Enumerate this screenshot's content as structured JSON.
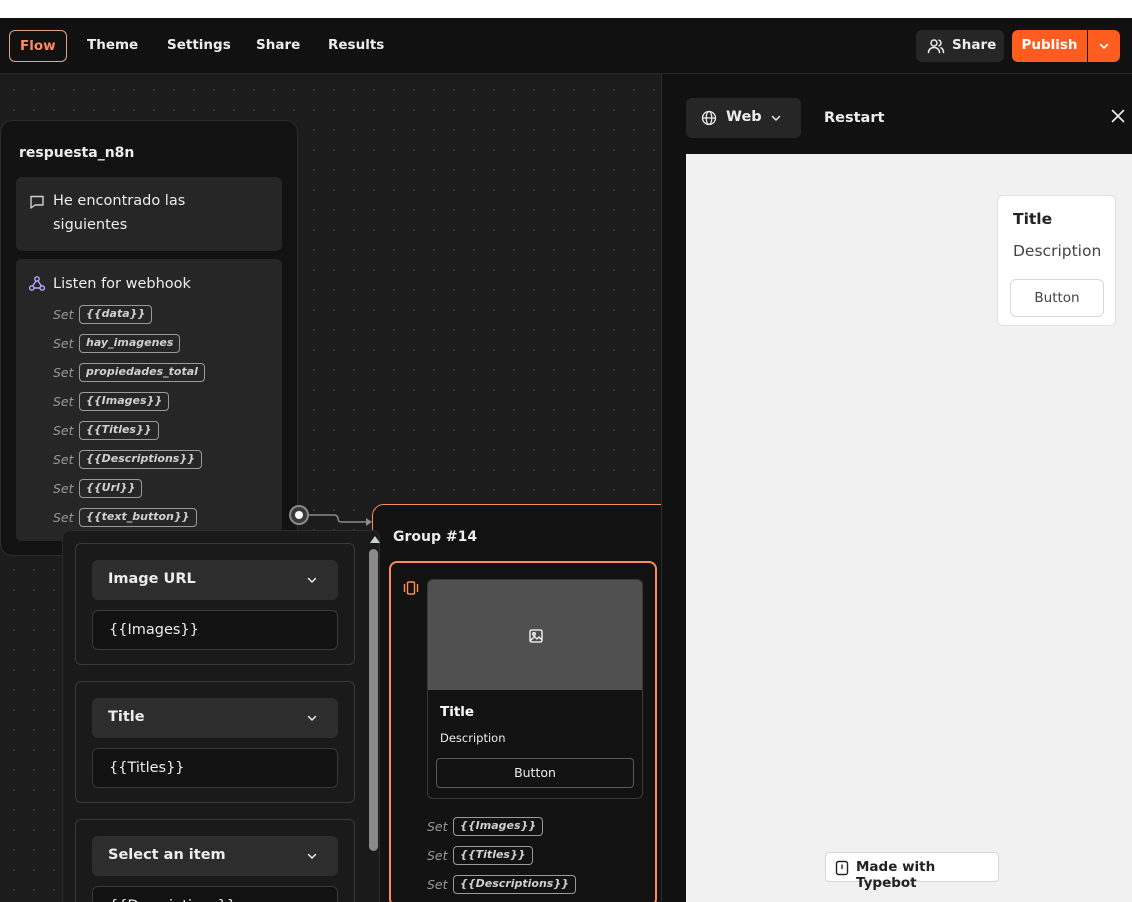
{
  "topbar": {
    "tabs": [
      {
        "label": "Flow",
        "active": true
      },
      {
        "label": "Theme",
        "active": false
      },
      {
        "label": "Settings",
        "active": false
      },
      {
        "label": "Share",
        "active": false
      },
      {
        "label": "Results",
        "active": false
      }
    ],
    "share_label": "Share",
    "publish_label": "Publish",
    "accent_color": "#ff5c1f"
  },
  "canvas": {
    "group1": {
      "title": "respuesta_n8n",
      "text_block": {
        "icon": "chat-bubble-icon",
        "line1": "He encontrado las",
        "line2": "siguientes"
      },
      "webhook_block": {
        "icon": "webhook-icon",
        "label": "Listen for webhook",
        "set_prefix": "Set",
        "variables": [
          "{{data}}",
          "hay_imagenes",
          "propiedades_total",
          "{{Images}}",
          "{{Titles}}",
          "{{Descriptions}}",
          "{{Url}}",
          "{{text_button}}"
        ]
      }
    },
    "group2": {
      "title": "Group #14",
      "card": {
        "title": "Title",
        "description": "Description",
        "button": "Button",
        "image_icon": "image-icon"
      },
      "set_prefix": "Set",
      "variables": [
        "{{Images}}",
        "{{Titles}}",
        "{{Descriptions}}"
      ]
    },
    "settings": {
      "fields": [
        {
          "select": "Image URL",
          "value": "{{Images}}"
        },
        {
          "select": "Title",
          "value": "{{Titles}}"
        },
        {
          "select": "Select an item",
          "value": "{{Descriptions}}"
        }
      ]
    }
  },
  "preview": {
    "web_label": "Web",
    "restart_label": "Restart",
    "card": {
      "title": "Title",
      "description": "Description",
      "button": "Button"
    },
    "made_with": "Made with Typebot"
  }
}
